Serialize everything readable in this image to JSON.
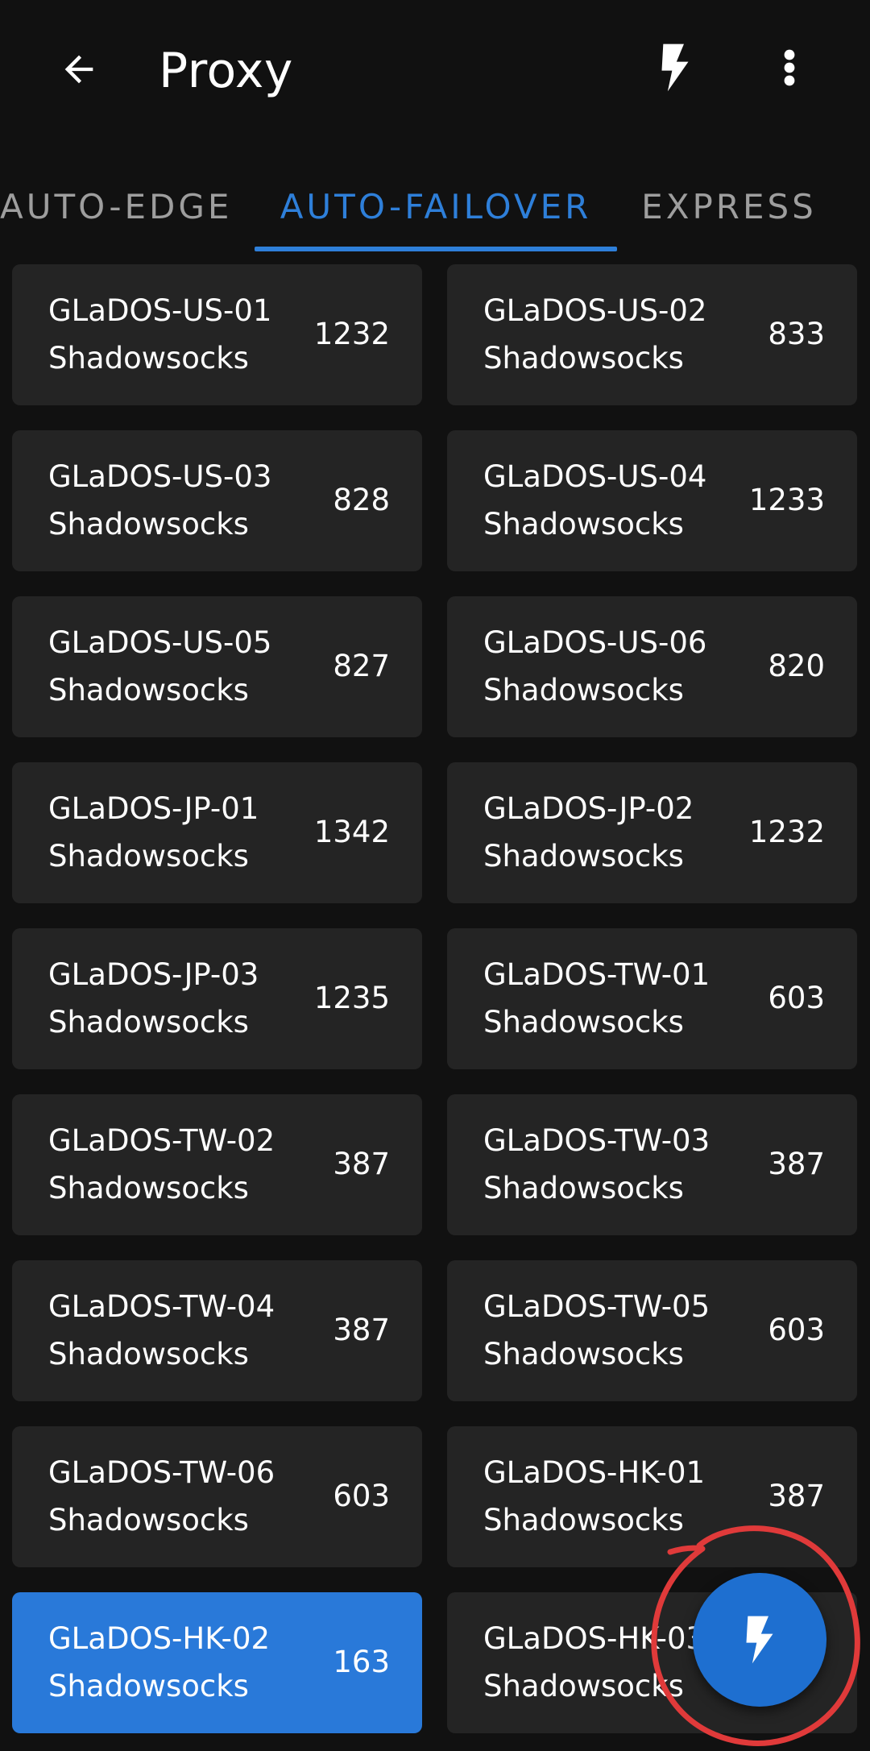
{
  "appbar": {
    "title": "Proxy",
    "back_icon": "arrow-back-icon",
    "action_icon": "lightning-bolt-icon",
    "menu_icon": "more-vert-icon"
  },
  "tabs": [
    {
      "label": "AUTO-EDGE",
      "selected": false
    },
    {
      "label": "AUTO-FAILOVER",
      "selected": true
    },
    {
      "label": "EXPRESS",
      "selected": false
    }
  ],
  "proxies": [
    {
      "name": "GLaDOS-US-01",
      "protocol": "Shadowsocks",
      "delay": "1232"
    },
    {
      "name": "GLaDOS-US-02",
      "protocol": "Shadowsocks",
      "delay": "833"
    },
    {
      "name": "GLaDOS-US-03",
      "protocol": "Shadowsocks",
      "delay": "828"
    },
    {
      "name": "GLaDOS-US-04",
      "protocol": "Shadowsocks",
      "delay": "1233"
    },
    {
      "name": "GLaDOS-US-05",
      "protocol": "Shadowsocks",
      "delay": "827"
    },
    {
      "name": "GLaDOS-US-06",
      "protocol": "Shadowsocks",
      "delay": "820"
    },
    {
      "name": "GLaDOS-JP-01",
      "protocol": "Shadowsocks",
      "delay": "1342"
    },
    {
      "name": "GLaDOS-JP-02",
      "protocol": "Shadowsocks",
      "delay": "1232"
    },
    {
      "name": "GLaDOS-JP-03",
      "protocol": "Shadowsocks",
      "delay": "1235"
    },
    {
      "name": "GLaDOS-TW-01",
      "protocol": "Shadowsocks",
      "delay": "603"
    },
    {
      "name": "GLaDOS-TW-02",
      "protocol": "Shadowsocks",
      "delay": "387"
    },
    {
      "name": "GLaDOS-TW-03",
      "protocol": "Shadowsocks",
      "delay": "387"
    },
    {
      "name": "GLaDOS-TW-04",
      "protocol": "Shadowsocks",
      "delay": "387"
    },
    {
      "name": "GLaDOS-TW-05",
      "protocol": "Shadowsocks",
      "delay": "603"
    },
    {
      "name": "GLaDOS-TW-06",
      "protocol": "Shadowsocks",
      "delay": "603"
    },
    {
      "name": "GLaDOS-HK-01",
      "protocol": "Shadowsocks",
      "delay": "387"
    },
    {
      "name": "GLaDOS-HK-02",
      "protocol": "Shadowsocks",
      "delay": "163",
      "selected": true
    },
    {
      "name": "GLaDOS-HK-03",
      "protocol": "Shadowsocks",
      "delay": ""
    }
  ],
  "fab": {
    "icon": "lightning-bolt-icon"
  },
  "colors": {
    "background": "#111111",
    "card": "#242424",
    "accent": "#2e7fd9",
    "selected_card": "#2979d9",
    "annotation": "#e03a3a"
  }
}
